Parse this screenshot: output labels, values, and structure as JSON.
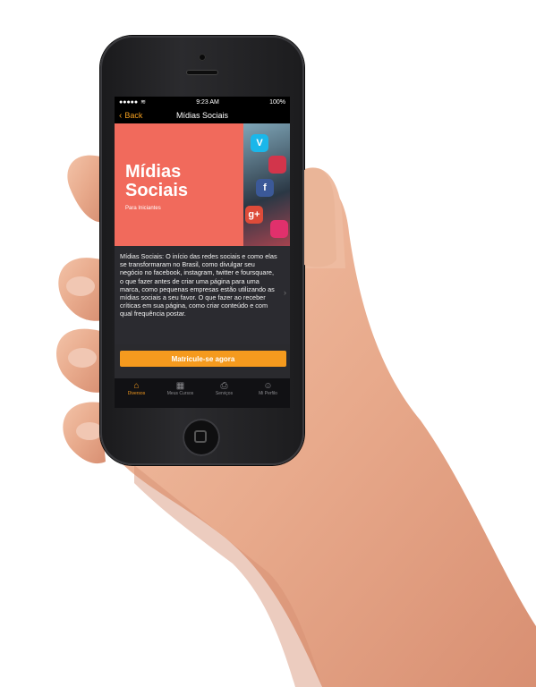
{
  "status_bar": {
    "signal": "●●●●●",
    "wifi_icon": "wifi-icon",
    "time": "9:23 AM",
    "battery": "100%"
  },
  "nav": {
    "back_label": "Back",
    "title": "Mídias Sociais"
  },
  "course": {
    "cover_title_line1": "Mídias",
    "cover_title_line2": "Sociais",
    "cover_subtitle": "Para Iniciantes",
    "description": "Mídias Sociais: O início das redes sociais e como elas se transformaram no Brasil, como divulgar seu negócio no facebook, instagram, twitter e foursquare, o que fazer antes de criar uma página para uma marca, como pequenas empresas estão utilizando as mídias sociais a seu favor. O que fazer ao receber críticas em sua página, como criar conteúdo e com qual frequência postar."
  },
  "enroll_button": "Matricule-se agora",
  "tabs": [
    {
      "label": "Diversos",
      "icon": "home-icon"
    },
    {
      "label": "Meus Cursos",
      "icon": "courses-icon"
    },
    {
      "label": "Serviços",
      "icon": "services-icon"
    },
    {
      "label": "Mi Perfilo",
      "icon": "profile-icon"
    }
  ],
  "colors": {
    "accent": "#f59a1e",
    "cover": "#f16a5c"
  }
}
